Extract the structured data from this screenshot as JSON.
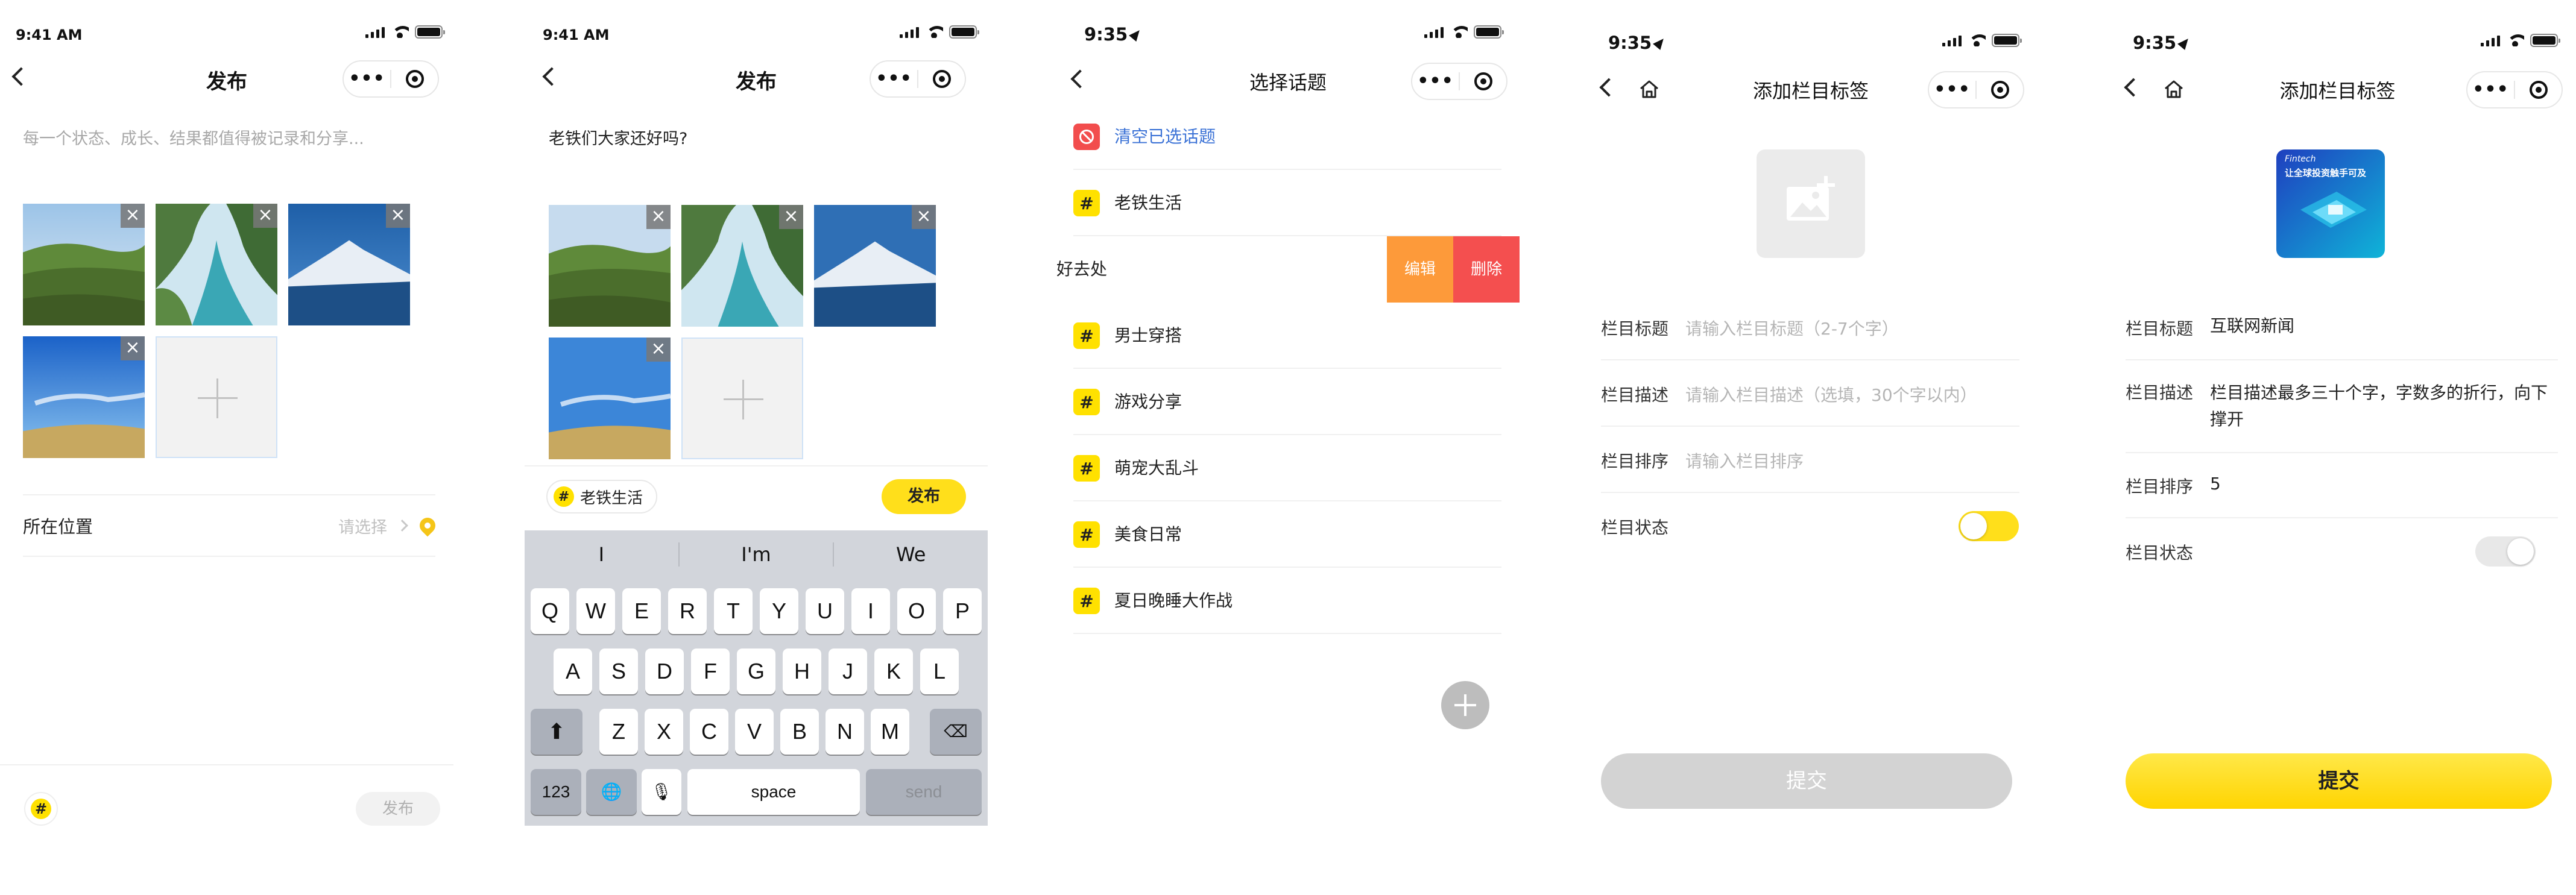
{
  "screens": [
    {
      "status_time": "9:41 AM",
      "title": "发布",
      "capsule_more": "•••",
      "placeholder": "每一个状态、成长、结果都值得被记录和分享...",
      "location_label": "所在位置",
      "location_value": "请选择",
      "hash_symbol": "#",
      "publish_label": "发布",
      "remove_symbol": "×"
    },
    {
      "status_time": "9:41 AM",
      "title": "发布",
      "capsule_more": "•••",
      "body_text": "老铁们大家还好吗?",
      "tag_hash": "#",
      "tag_label": "老铁生活",
      "publish_label": "发布",
      "remove_symbol": "×",
      "keyboard": {
        "suggestions": [
          "I",
          "I'm",
          "We"
        ],
        "row1": [
          "Q",
          "W",
          "E",
          "R",
          "T",
          "Y",
          "U",
          "I",
          "O",
          "P"
        ],
        "row2": [
          "A",
          "S",
          "D",
          "F",
          "G",
          "H",
          "J",
          "K",
          "L"
        ],
        "row3": [
          "Z",
          "X",
          "C",
          "V",
          "B",
          "N",
          "M"
        ],
        "shift_icon": "⬆",
        "delete_icon": "⌫",
        "numbers_label": "123",
        "globe_icon": "🌐",
        "mic_icon": "🎙",
        "space_label": "space",
        "send_label": "send"
      }
    },
    {
      "status_time": "9:35",
      "title": "选择话题",
      "capsule_more": "•••",
      "clear_label": "清空已选话题",
      "hash_symbol": "#",
      "topics": [
        "老铁生活",
        "男士穿搭",
        "游戏分享",
        "萌宠大乱斗",
        "美食日常",
        "夏日晚睡大作战"
      ],
      "swiped_topic": "好去处",
      "edit_label": "编辑",
      "delete_label": "删除"
    },
    {
      "status_time": "9:35",
      "title": "添加栏目标签",
      "capsule_more": "•••",
      "fields": [
        {
          "label": "栏目标题",
          "placeholder": "请输入栏目标题（2-7个字）"
        },
        {
          "label": "栏目描述",
          "placeholder": "请输入栏目描述（选填，30个字以内）"
        },
        {
          "label": "栏目排序",
          "placeholder": "请输入栏目排序"
        }
      ],
      "status_label": "栏目状态",
      "submit_label": "提交"
    },
    {
      "status_time": "9:35",
      "title": "添加栏目标签",
      "capsule_more": "•••",
      "cover_line1": "Fintech",
      "cover_line2": "让全球投资触手可及",
      "fields": [
        {
          "label": "栏目标题",
          "value": "互联网新闻"
        },
        {
          "label": "栏目描述",
          "value": "栏目描述最多三十个字，字数多的折行，向下撑开"
        },
        {
          "label": "栏目排序",
          "value": "5"
        }
      ],
      "status_label": "栏目状态",
      "submit_label": "提交"
    }
  ],
  "colors": {
    "accent_yellow": "#ffdf1b",
    "edit_orange": "#fd9a3a",
    "delete_red": "#f44f4f",
    "link_blue": "#3b72d6"
  }
}
